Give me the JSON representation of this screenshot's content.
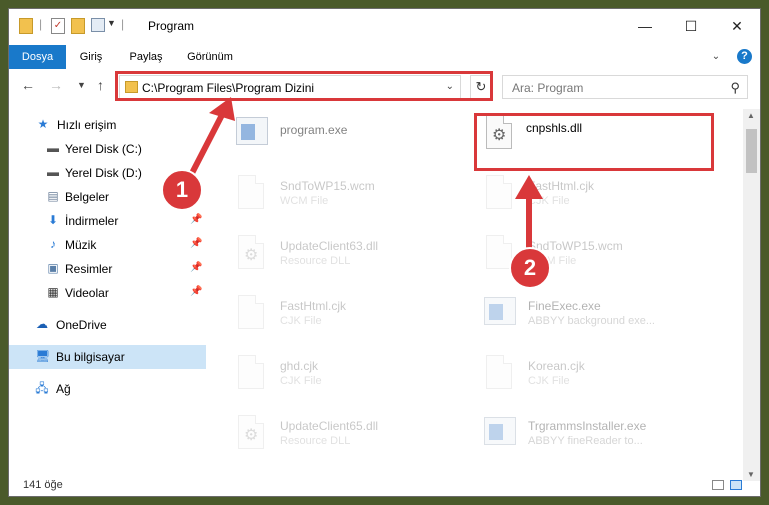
{
  "window": {
    "title": "Program",
    "controls": {
      "minimize": "—",
      "maximize": "☐",
      "close": "✕"
    }
  },
  "ribbon": {
    "tabs": [
      {
        "label": "Dosya"
      },
      {
        "label": "Giriş"
      },
      {
        "label": "Paylaş"
      },
      {
        "label": "Görünüm"
      }
    ],
    "help": "?"
  },
  "nav": {
    "address": "C:\\Program Files\\Program Dizini",
    "search_placeholder": "Ara: Program"
  },
  "sidebar": {
    "items": [
      {
        "label": "Hızlı erişim",
        "icon": "star-icon"
      },
      {
        "label": "Yerel Disk (C:)",
        "icon": "drive-icon"
      },
      {
        "label": "Yerel Disk (D:)",
        "icon": "drive-icon"
      },
      {
        "label": "Belgeler",
        "icon": "documents-icon"
      },
      {
        "label": "İndirmeler",
        "icon": "downloads-icon"
      },
      {
        "label": "Müzik",
        "icon": "music-icon"
      },
      {
        "label": "Resimler",
        "icon": "pictures-icon"
      },
      {
        "label": "Videolar",
        "icon": "videos-icon"
      },
      {
        "label": "OneDrive",
        "icon": "cloud-icon"
      },
      {
        "label": "Bu bilgisayar",
        "icon": "computer-icon"
      },
      {
        "label": "Ağ",
        "icon": "network-icon"
      }
    ]
  },
  "files": [
    {
      "name": "program.exe",
      "type": ""
    },
    {
      "name": "cnpshls.dll",
      "type": ""
    },
    {
      "name": "SndToWP15.wcm",
      "type": "WCM File"
    },
    {
      "name": "FastHtml.cjk",
      "type": "CJK File"
    },
    {
      "name": "UpdateClient63.dll",
      "type": "Resource DLL"
    },
    {
      "name": "SndToWP15.wcm",
      "type": "WCM File"
    },
    {
      "name": "FastHtml.cjk",
      "type": "CJK File"
    },
    {
      "name": "FineExec.exe",
      "type": "ABBYY background exe..."
    },
    {
      "name": "ghd.cjk",
      "type": "CJK File"
    },
    {
      "name": "Korean.cjk",
      "type": "CJK File"
    },
    {
      "name": "UpdateClient65.dll",
      "type": "Resource DLL"
    },
    {
      "name": "TrgrammsInstaller.exe",
      "type": "ABBYY fineReader to..."
    }
  ],
  "status": {
    "count": "141 öğe"
  },
  "callouts": {
    "one": "1",
    "two": "2"
  },
  "colors": {
    "accent": "#1979ca",
    "annotation": "#d9383a",
    "selected": "#cce4f7"
  }
}
